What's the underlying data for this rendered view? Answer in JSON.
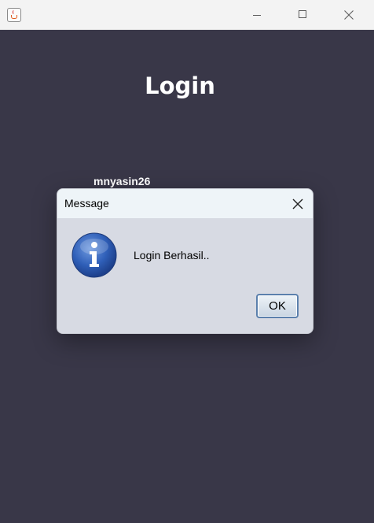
{
  "window": {
    "app_icon": "java-icon",
    "controls": [
      "minimize-icon",
      "maximize-icon",
      "close-icon"
    ]
  },
  "login": {
    "title": "Login",
    "username": "mnyasin26"
  },
  "dialog": {
    "title": "Message",
    "message": "Login Berhasil..",
    "icon": "info-icon",
    "ok_label": "OK"
  },
  "colors": {
    "background": "#393748",
    "dialog_body": "#d7dae3",
    "dialog_header": "#eef4f8",
    "ok_border": "#5b80ad"
  }
}
